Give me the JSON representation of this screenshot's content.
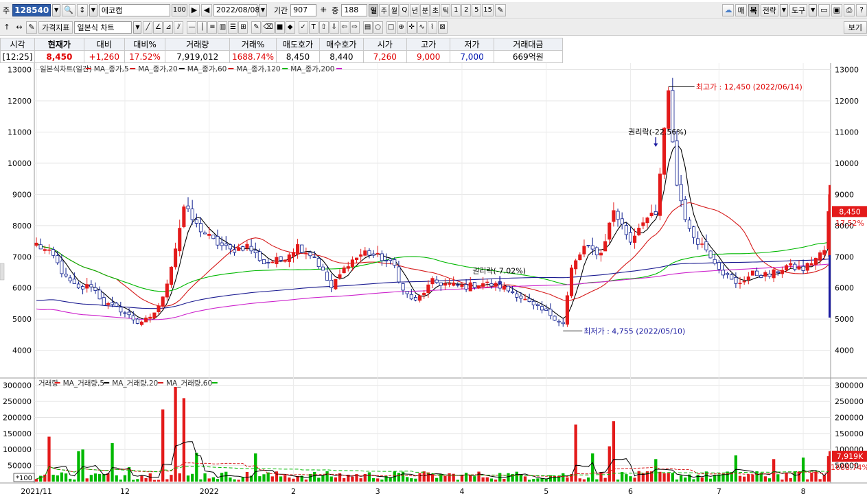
{
  "toolbar1": {
    "prefix": "주",
    "stock_code": "128540",
    "stock_name": "에코캡",
    "name_badge": "100",
    "date": "2022/08/08",
    "period_label": "기간",
    "period_value": "907",
    "mid_label": "중",
    "mid_value": "188",
    "timeframes": [
      "일",
      "주",
      "월",
      "Q",
      "년",
      "분",
      "초",
      "틱",
      "1",
      "2",
      "5",
      "15"
    ],
    "active_timeframe": "일",
    "right_buttons": [
      "매",
      "복",
      "전략",
      "도구"
    ]
  },
  "toolbar2": {
    "indicator_label": "가격지표",
    "chart_type": "일본식 차트",
    "view_label": "보기"
  },
  "quote": {
    "headers": [
      "시각",
      "현재가",
      "대비",
      "대비%",
      "거래량",
      "거래%",
      "매도호가",
      "매수호가",
      "시가",
      "고가",
      "저가",
      "거래대금"
    ],
    "values": [
      "[12:25]",
      "8,450",
      "+1,260",
      "17.52%",
      "7,919,012",
      "1688.74%",
      "8,450",
      "8,440",
      "7,260",
      "9,000",
      "7,000",
      "669억원"
    ]
  },
  "colors": {
    "up": "#e31a1a",
    "down": "#0a1a8c",
    "ma5": "#000000",
    "ma20": "#d61a1a",
    "ma60": "#00b800",
    "ma120": "#1a1a90",
    "ma200": "#cc22cc"
  },
  "chart_data": {
    "type": "candlestick",
    "price_legend": [
      "일본식차트(일간)",
      "MA_종가,5",
      "MA_종가,20",
      "MA_종가,60",
      "MA_종가,120",
      "MA_종가,200"
    ],
    "volume_legend": [
      "거래량",
      "MA_거래량,5",
      "MA_거래량,20",
      "MA_거래량,60"
    ],
    "price_axis": {
      "ticks": [
        4000,
        5000,
        6000,
        7000,
        8000,
        9000,
        10000,
        11000,
        12000,
        13000
      ],
      "range": [
        3200,
        13100
      ]
    },
    "volume_axis": {
      "ticks": [
        50000,
        100000,
        150000,
        200000,
        250000,
        300000
      ],
      "range": [
        0,
        310000
      ],
      "unit_label": "*100"
    },
    "x_labels": [
      "2021/11",
      "12",
      "2022",
      "2",
      "3",
      "4",
      "5",
      "6",
      "7",
      "8"
    ],
    "x_label_index": [
      0,
      21,
      41,
      61,
      81,
      101,
      121,
      141,
      162,
      182
    ],
    "n_days": 189,
    "anchors": [
      [
        0,
        7400
      ],
      [
        4,
        7000
      ],
      [
        7,
        6300
      ],
      [
        10,
        5950
      ],
      [
        13,
        6100
      ],
      [
        16,
        5500
      ],
      [
        20,
        5300
      ],
      [
        24,
        4900
      ],
      [
        27,
        5000
      ],
      [
        30,
        5650
      ],
      [
        33,
        7300
      ],
      [
        35,
        8600
      ],
      [
        38,
        8000
      ],
      [
        42,
        7500
      ],
      [
        46,
        7200
      ],
      [
        50,
        7350
      ],
      [
        54,
        6800
      ],
      [
        58,
        6900
      ],
      [
        62,
        7350
      ],
      [
        66,
        7000
      ],
      [
        70,
        6000
      ],
      [
        74,
        6800
      ],
      [
        78,
        7150
      ],
      [
        82,
        6950
      ],
      [
        85,
        6700
      ],
      [
        87,
        5900
      ],
      [
        90,
        5550
      ],
      [
        94,
        6200
      ],
      [
        98,
        6100
      ],
      [
        102,
        6050
      ],
      [
        106,
        6150
      ],
      [
        110,
        6050
      ],
      [
        114,
        5800
      ],
      [
        118,
        5400
      ],
      [
        122,
        5150
      ],
      [
        125,
        4850
      ],
      [
        127,
        6600
      ],
      [
        130,
        7300
      ],
      [
        134,
        7100
      ],
      [
        137,
        8500
      ],
      [
        141,
        7500
      ],
      [
        144,
        8200
      ],
      [
        147,
        8300
      ],
      [
        149,
        11000
      ],
      [
        150,
        12200
      ],
      [
        152,
        9300
      ],
      [
        155,
        7800
      ],
      [
        159,
        7250
      ],
      [
        163,
        6500
      ],
      [
        166,
        6100
      ],
      [
        170,
        6450
      ],
      [
        174,
        6400
      ],
      [
        178,
        6700
      ],
      [
        182,
        6600
      ],
      [
        185,
        6950
      ],
      [
        187,
        7200
      ],
      [
        188,
        8450
      ]
    ],
    "volume_spikes": [
      [
        3,
        140000
      ],
      [
        10,
        95000
      ],
      [
        11,
        100000
      ],
      [
        18,
        120000
      ],
      [
        22,
        45000
      ],
      [
        30,
        225000
      ],
      [
        33,
        295000
      ],
      [
        35,
        260000
      ],
      [
        38,
        90000
      ],
      [
        52,
        88000
      ],
      [
        128,
        178000
      ],
      [
        132,
        88000
      ],
      [
        136,
        110000
      ],
      [
        137,
        188000
      ],
      [
        147,
        70000
      ],
      [
        166,
        82000
      ],
      [
        175,
        70000
      ],
      [
        182,
        75000
      ],
      [
        188,
        79190
      ]
    ],
    "annotations": [
      {
        "text": "최고가 : 12,450 (2022/06/14)",
        "day": 150,
        "price": 12450,
        "kind": "high"
      },
      {
        "text": "최저가 : 4,755 (2022/05/10)",
        "day": 125,
        "price": 4755,
        "kind": "low"
      },
      {
        "text": "권리락(-22.56%)",
        "day": 147,
        "price": 10700,
        "kind": "event"
      },
      {
        "text": "권리락(-7.02%)",
        "day": 110,
        "price": 6250,
        "kind": "event"
      }
    ],
    "last_price": {
      "price_label": "8,450",
      "pct_label": "17.52%",
      "price": 8450,
      "pct_price": 8080
    },
    "last_volume": {
      "vol_label": "7,919K",
      "pct_label": "1688.74%",
      "vol": 79190
    },
    "grid": true
  }
}
